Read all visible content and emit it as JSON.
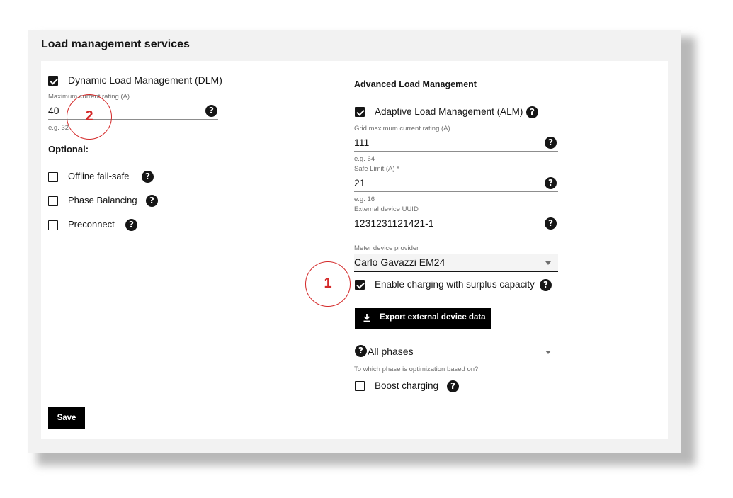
{
  "title": "Load management services",
  "left": {
    "dlm": {
      "label": "Dynamic Load Management (DLM)",
      "checked": true
    },
    "max_current": {
      "label": "Maximum current rating (A)",
      "value": "40",
      "hint": "e.g. 32"
    },
    "optional_heading": "Optional:",
    "options": [
      {
        "label": "Offline fail-safe",
        "checked": false
      },
      {
        "label": "Phase Balancing",
        "checked": false
      },
      {
        "label": "Preconnect",
        "checked": false
      }
    ]
  },
  "right": {
    "heading": "Advanced Load Management",
    "alm": {
      "label": "Adaptive Load Management (ALM)",
      "checked": true
    },
    "grid_max": {
      "label": "Grid maximum current rating (A)",
      "value": "111",
      "hint": "e.g. 64"
    },
    "safe_limit": {
      "label": "Safe Limit (A) *",
      "value": "21",
      "hint": "e.g. 16"
    },
    "uuid": {
      "label": "External device UUID",
      "value": "1231231121421-1"
    },
    "meter": {
      "label": "Meter device provider",
      "value": "Carlo Gavazzi EM24"
    },
    "surplus": {
      "label": "Enable charging with surplus capacity",
      "checked": true
    },
    "export_button": "Export external device data",
    "phases": {
      "value": "All phases",
      "hint": "To which phase is optimization based on?"
    },
    "boost": {
      "label": "Boost charging",
      "checked": false
    }
  },
  "save_button": "Save",
  "annotations": [
    "1",
    "2"
  ],
  "help_glyph": "?",
  "colors": {
    "accent": "#161616",
    "annotation": "#d42a2a",
    "panel_bg": "#f2f2f2"
  }
}
